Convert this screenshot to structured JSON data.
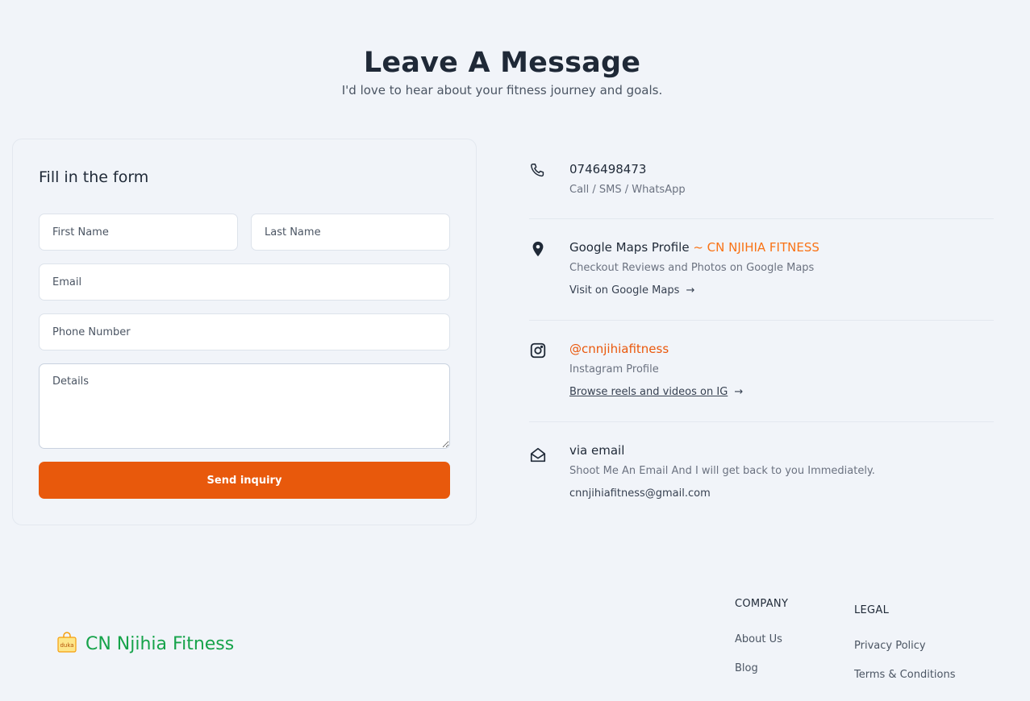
{
  "hero": {
    "title": "Leave A Message",
    "subtitle": "I'd love to hear about your fitness journey and goals."
  },
  "form": {
    "heading": "Fill in the form",
    "first_name_placeholder": "First Name",
    "last_name_placeholder": "Last Name",
    "email_placeholder": "Email",
    "phone_placeholder": "Phone Number",
    "details_placeholder": "Details",
    "submit_label": "Send inquiry",
    "submit_color": "#e8590c"
  },
  "contacts": {
    "phone": {
      "icon": "phone-icon",
      "title": "0746498473",
      "subtitle": "Call / SMS / WhatsApp"
    },
    "maps": {
      "icon": "map-pin-icon",
      "title": "Google Maps Profile",
      "title_accent": "~ CN NJIHIA FITNESS",
      "subtitle": "Checkout Reviews and Photos on Google Maps",
      "link": "Visit on Google Maps"
    },
    "instagram": {
      "icon": "instagram-icon",
      "title": "@cnnjihiafitness",
      "subtitle": "Instagram Profile",
      "link": "Browse reels and videos on IG"
    },
    "email": {
      "icon": "envelope-open-icon",
      "title": "via email",
      "subtitle": "Shoot Me An Email And I will get back to you Immediately.",
      "address": "cnnjihiafitness@gmail.com"
    }
  },
  "footer": {
    "brand_icon_text": "duka",
    "brand_name": "CN Njihia Fitness",
    "brand_color": "#16a34a",
    "company": {
      "heading": "COMPANY",
      "links": [
        "About Us",
        "Blog"
      ]
    },
    "legal": {
      "heading": "LEGAL",
      "links": [
        "Privacy Policy",
        "Terms & Conditions"
      ]
    }
  },
  "colors": {
    "background": "#f1f4f9",
    "accent": "#f97316",
    "button": "#e8590c"
  }
}
